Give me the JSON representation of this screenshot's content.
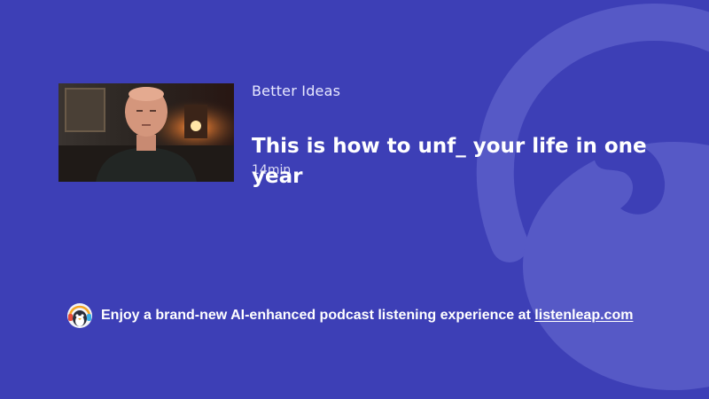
{
  "episode": {
    "channel": "Better Ideas",
    "title": "This is how to unf_ your life in one year",
    "duration": "14min"
  },
  "footer": {
    "promo_text": "Enjoy a brand-new AI-enhanced podcast listening experience at ",
    "link_text": "listenleap.com"
  },
  "icons": {
    "background": "headphones-logo",
    "mascot": "penguin-headphones"
  },
  "colors": {
    "background": "#3d3fb6",
    "logo_watermark": "#5558c4",
    "text": "#ffffff"
  }
}
